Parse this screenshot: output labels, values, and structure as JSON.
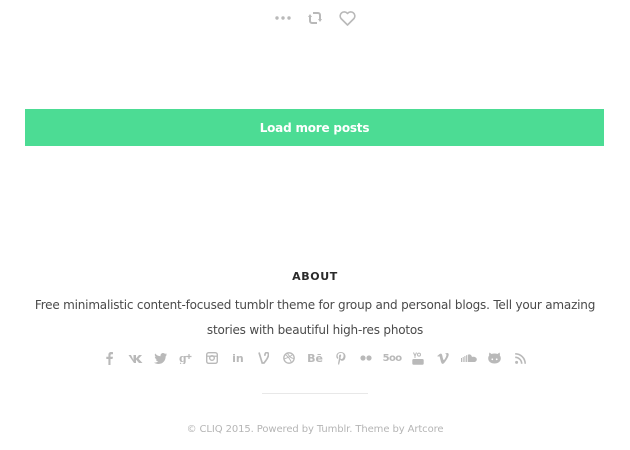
{
  "post_actions": {
    "icons": [
      "more-dots-icon",
      "reblog-icon",
      "heart-icon"
    ]
  },
  "load_more": {
    "label": "Load more posts"
  },
  "colors": {
    "accent": "#4cdc94",
    "icon_gray": "#b9b9b9",
    "divider": "#e8e8e8"
  },
  "about": {
    "title": "ABOUT",
    "text": "Free minimalistic content-focused tumblr theme for group and personal blogs. Tell your amazing stories with beautiful high-res photos"
  },
  "social": {
    "icons": [
      "facebook-icon",
      "vk-icon",
      "twitter-icon",
      "google-plus-icon",
      "instagram-icon",
      "linkedin-icon",
      "vine-icon",
      "dribbble-icon",
      "behance-icon",
      "pinterest-icon",
      "flickr-icon",
      "500px-icon",
      "youtube-icon",
      "vimeo-icon",
      "soundcloud-icon",
      "github-icon",
      "rss-icon"
    ],
    "labels": {
      "linkedin": "in",
      "behance": "Bē",
      "px500": "5oo"
    }
  },
  "footer": {
    "copyright": "© CLIQ 2015. Powered by Tumblr. Theme by Artcore"
  }
}
